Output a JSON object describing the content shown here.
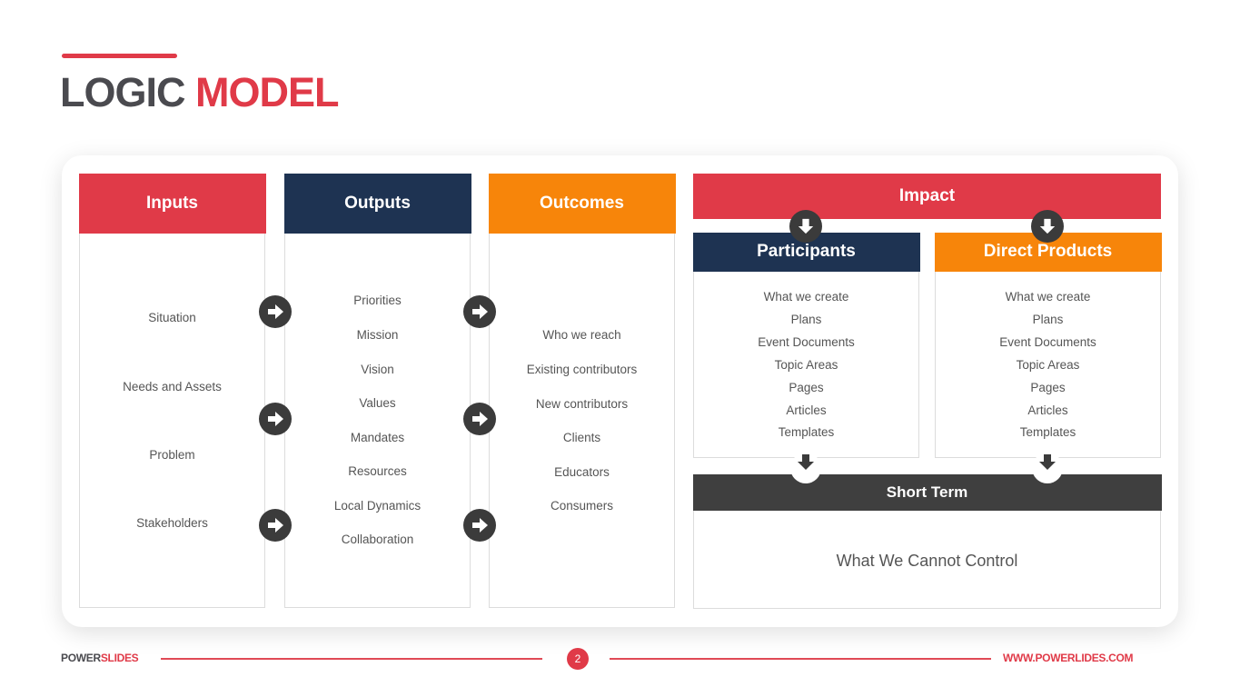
{
  "title": {
    "part1": "LOGIC",
    "part2": "MODEL"
  },
  "colors": {
    "red": "#e03a48",
    "navy": "#1e3352",
    "orange": "#f7850a",
    "dark": "#3f3f3f",
    "text": "#555555"
  },
  "columns": [
    {
      "header": "Inputs",
      "items": [
        "Situation",
        "Needs and Assets",
        "Problem",
        "Stakeholders"
      ]
    },
    {
      "header": "Outputs",
      "items": [
        "Priorities",
        "Mission",
        "Vision",
        "Values",
        "Mandates",
        "Resources",
        "Local Dynamics",
        "Collaboration"
      ]
    },
    {
      "header": "Outcomes",
      "items": [
        "Who we reach",
        "Existing contributors",
        "New contributors",
        "Clients",
        "Educators",
        "Consumers"
      ]
    }
  ],
  "impact": {
    "header": "Impact",
    "participants": {
      "header": "Participants",
      "items": [
        "What we create",
        "Plans",
        "Event Documents",
        "Topic Areas",
        "Pages",
        "Articles",
        "Templates"
      ]
    },
    "direct_products": {
      "header": "Direct Products",
      "items": [
        "What we create",
        "Plans",
        "Event Documents",
        "Topic Areas",
        "Pages",
        "Articles",
        "Templates"
      ]
    },
    "short_term": {
      "header": "Short Term",
      "body": "What We Cannot Control"
    }
  },
  "icons": {
    "right_arrow": "arrow-right-circle",
    "down_arrow": "arrow-down-circle"
  },
  "footer": {
    "brand_part1": "POWER",
    "brand_part2": "SLIDES",
    "page_number": "2",
    "url": "WWW.POWERLIDES.COM"
  }
}
